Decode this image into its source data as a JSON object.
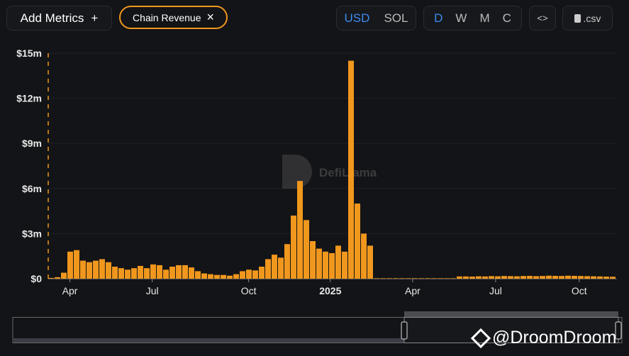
{
  "toolbar": {
    "add_metrics": "Add Metrics",
    "add_icon": "+",
    "chip_label": "Chain Revenue",
    "chip_close": "×",
    "currency": [
      "USD",
      "SOL"
    ],
    "period": [
      "D",
      "W",
      "M",
      "C"
    ],
    "embed": "<>",
    "csv": ".csv"
  },
  "watermark": {
    "defillama": "DefiLlama",
    "droomdroom": "@DroomDroom"
  },
  "colors": {
    "bar": "#f0971d",
    "accent": "#3d8cf0",
    "background": "#131417"
  },
  "chart_data": {
    "type": "bar",
    "title": "Chain Revenue",
    "xlabel": "",
    "ylabel": "",
    "x_start": "2024-03-01",
    "interval_days": 7,
    "yticks": [
      "$0",
      "$3m",
      "$6m",
      "$9m",
      "$12m",
      "$15m"
    ],
    "ylim": [
      0,
      15
    ],
    "unit": "USD millions",
    "xticks": [
      {
        "label": "Apr",
        "i": 3.4
      },
      {
        "label": "Jul",
        "i": 16.3
      },
      {
        "label": "Oct",
        "i": 31.4
      },
      {
        "label": "2025",
        "i": 44.2,
        "bold": true
      },
      {
        "label": "Apr",
        "i": 57.1
      },
      {
        "label": "Jul",
        "i": 70.1
      },
      {
        "label": "Oct",
        "i": 83.2
      }
    ],
    "values": [
      0.05,
      0.1,
      0.4,
      1.8,
      1.9,
      1.2,
      1.1,
      1.2,
      1.3,
      1.1,
      0.8,
      0.7,
      0.6,
      0.7,
      0.85,
      0.7,
      0.95,
      0.9,
      0.6,
      0.8,
      0.9,
      0.9,
      0.75,
      0.5,
      0.35,
      0.3,
      0.25,
      0.25,
      0.2,
      0.3,
      0.5,
      0.6,
      0.55,
      0.8,
      1.3,
      1.6,
      1.4,
      2.3,
      4.2,
      6.5,
      3.9,
      2.5,
      2.0,
      1.8,
      1.7,
      2.2,
      1.8,
      14.5,
      5.0,
      3.0,
      2.2,
      0.03,
      0.03,
      0.03,
      0.03,
      0.03,
      0.03,
      0.03,
      0.03,
      0.03,
      0.03,
      0.03,
      0.03,
      0.03,
      0.15,
      0.15,
      0.14,
      0.16,
      0.15,
      0.17,
      0.16,
      0.18,
      0.17,
      0.16,
      0.18,
      0.19,
      0.17,
      0.18,
      0.2,
      0.19,
      0.18,
      0.2,
      0.19,
      0.18,
      0.17,
      0.16,
      0.15,
      0.14,
      0.13
    ]
  }
}
